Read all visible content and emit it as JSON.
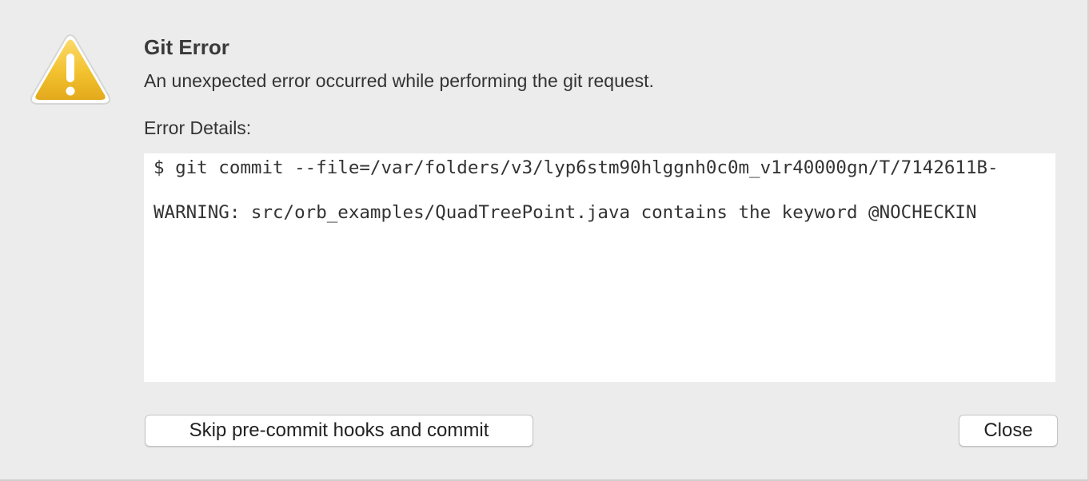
{
  "dialog": {
    "title": "Git Error",
    "message": "An unexpected error occurred while performing the git request.",
    "details_label": "Error Details:",
    "details_lines": [
      "$ git commit --file=/var/folders/v3/lyp6stm90hlggnh0c0m_v1r40000gn/T/7142611B-",
      "WARNING: src/orb_examples/QuadTreePoint.java contains the keyword @NOCHECKIN"
    ],
    "icon": "warning-icon"
  },
  "buttons": {
    "skip_label": "Skip pre-commit hooks and commit",
    "close_label": "Close"
  },
  "colors": {
    "icon_yellow": "#f2c12e",
    "icon_yellow_dark": "#d9a21b",
    "background": "#ececec"
  }
}
